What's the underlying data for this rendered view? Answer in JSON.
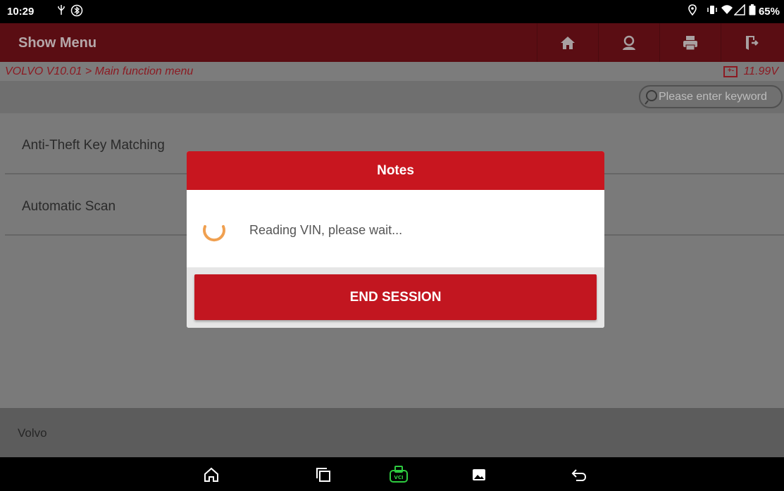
{
  "status_bar": {
    "time": "10:29",
    "battery": "65%",
    "icons": [
      "usb-debug-icon",
      "bluetooth-icon",
      "location-icon",
      "vibrate-icon",
      "wifi-icon",
      "signal-icon",
      "battery-icon"
    ]
  },
  "header": {
    "title": "Show Menu",
    "buttons": [
      "home-icon",
      "user-support-icon",
      "print-icon",
      "exit-icon"
    ],
    "accent": "#c8161f"
  },
  "breadcrumb": {
    "path": "VOLVO V10.01 > Main function menu",
    "voltage": "11.99V"
  },
  "search": {
    "placeholder": "Please enter keyword"
  },
  "menu": {
    "items": [
      {
        "label": "Anti-Theft Key Matching"
      },
      {
        "label": "Automatic Scan"
      }
    ]
  },
  "footer": {
    "label": "Volvo"
  },
  "dialog": {
    "title": "Notes",
    "message": "Reading VIN, please wait...",
    "button_label": "END SESSION",
    "spinner_color": "#f0a050"
  },
  "navbar": {
    "buttons": [
      "home-nav-icon",
      "recents-icon",
      "vci-icon",
      "gallery-icon",
      "back-icon"
    ]
  }
}
